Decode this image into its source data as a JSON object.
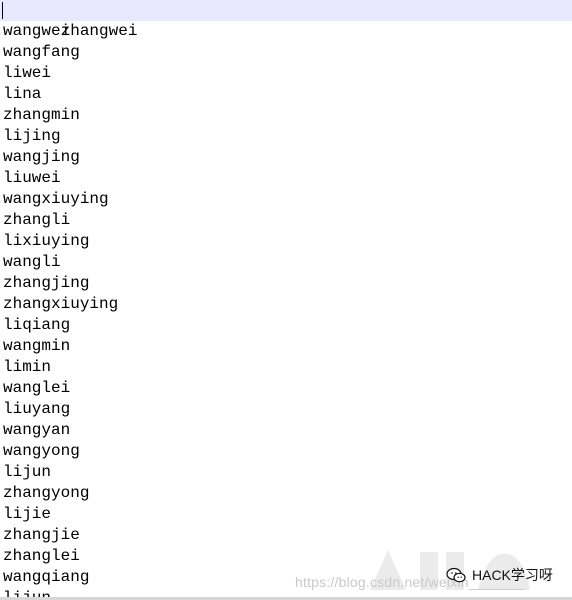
{
  "editor": {
    "lines": [
      "zhangwei",
      "wangwei",
      "wangfang",
      "liwei",
      "lina",
      "zhangmin",
      "lijing",
      "wangjing",
      "liuwei",
      "wangxiuying",
      "zhangli",
      "lixiuying",
      "wangli",
      "zhangjing",
      "zhangxiuying",
      "liqiang",
      "wangmin",
      "limin",
      "wanglei",
      "liuyang",
      "wangyan",
      "wangyong",
      "lijun",
      "zhangyong",
      "lijie",
      "zhangjie",
      "zhanglei",
      "wangqiang"
    ],
    "partial_line": "lijun",
    "current_line_index": 0
  },
  "watermark": {
    "url": "https://blog.csdn.net/weixin_______",
    "brand": "HACK学习呀",
    "icon": "wechat-icon",
    "colors": {
      "url": "#c9c9c9",
      "brand": "#111111"
    }
  },
  "colors": {
    "current_line_highlight": "#e8e8ff",
    "text": "#000000",
    "background": "#ffffff"
  }
}
